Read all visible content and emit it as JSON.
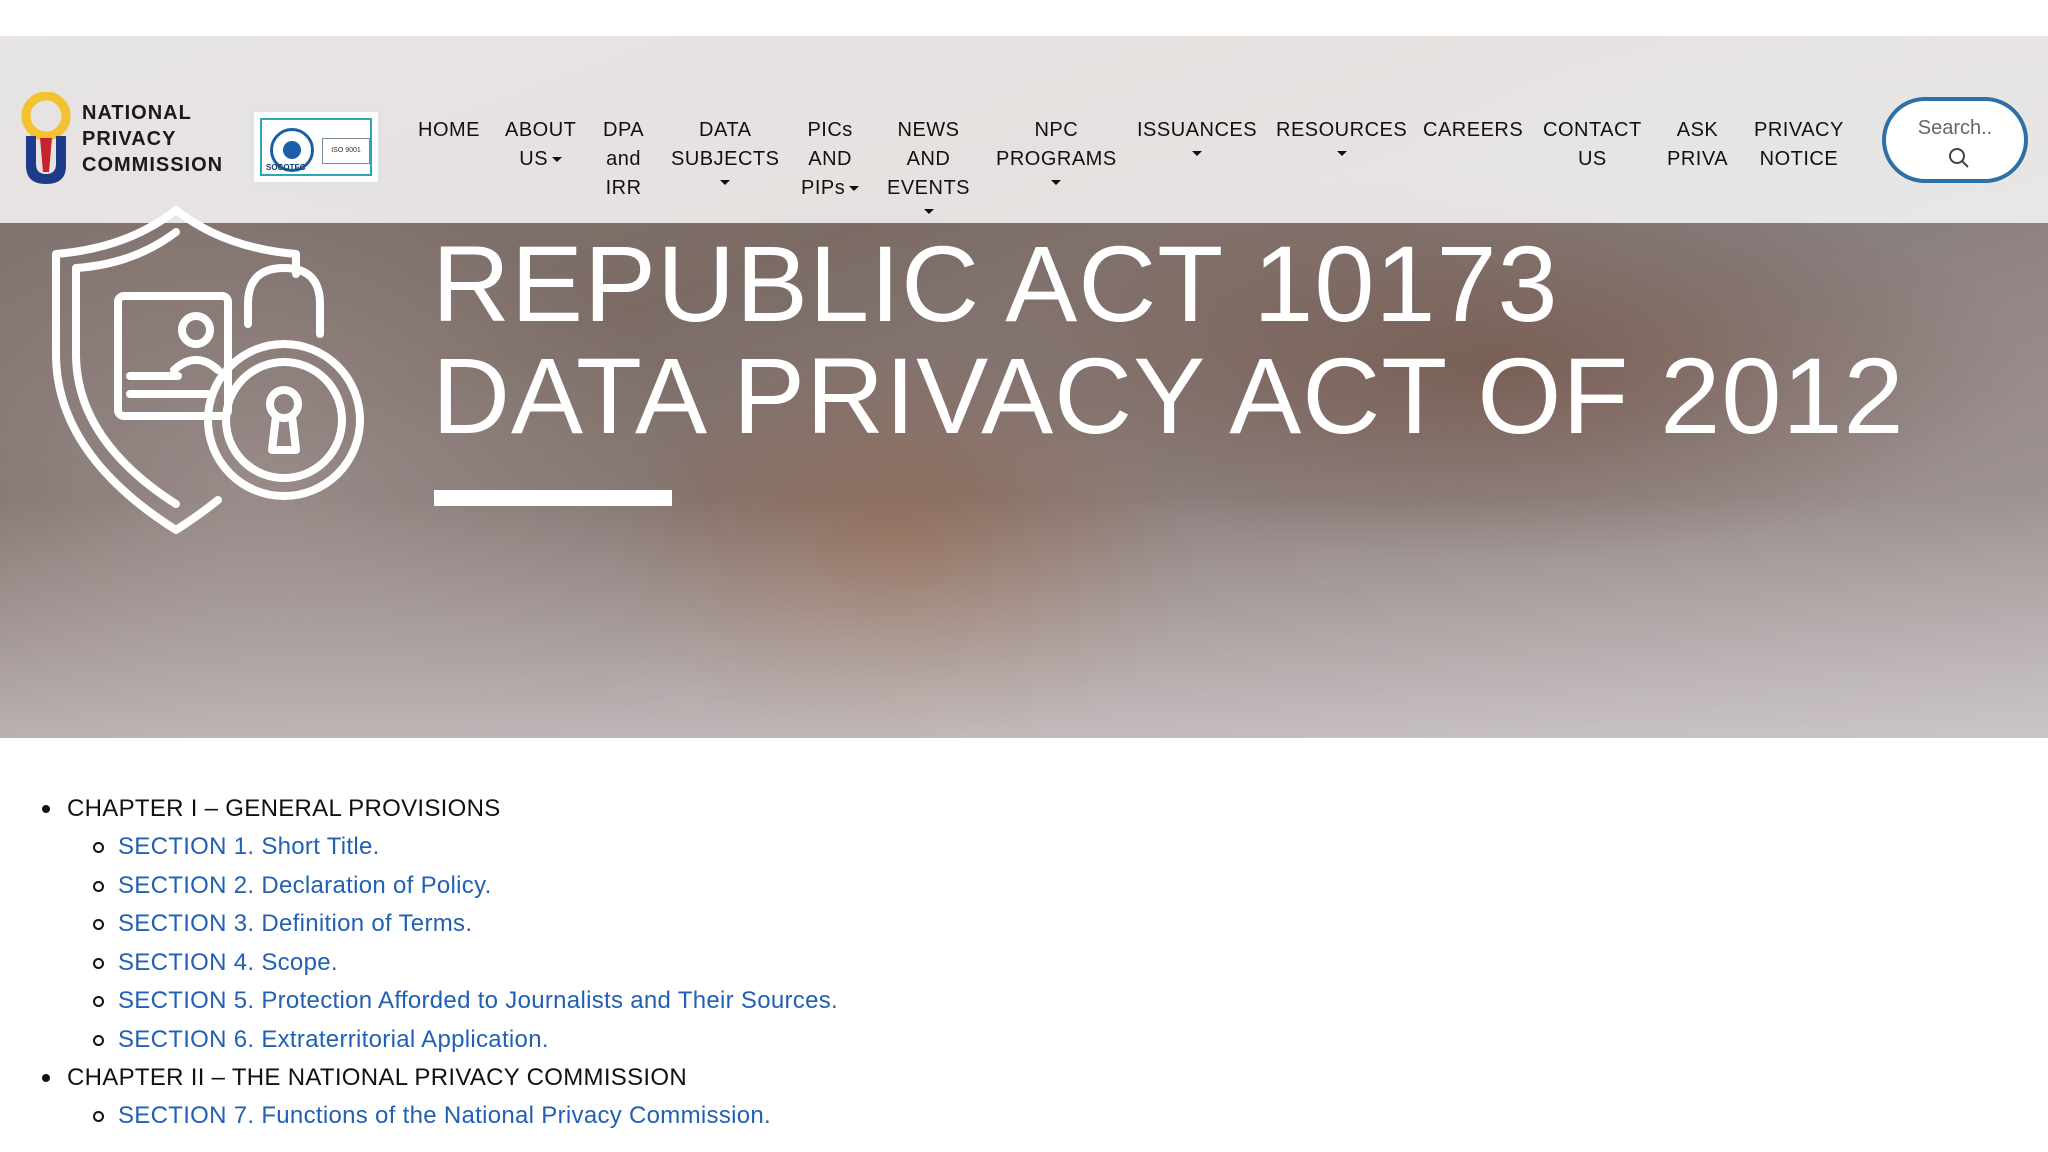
{
  "logo": {
    "line1": "NATIONAL",
    "line2": "PRIVACY",
    "line3": "COMMISSION",
    "colors": {
      "yellow": "#f2c230",
      "blue": "#1e3a8a",
      "red": "#c8232c"
    }
  },
  "certification": {
    "brand": "SOCOTEC",
    "standard": "ISO 9001"
  },
  "nav": {
    "home": "HOME",
    "about_1": "ABOUT",
    "about_2": "US",
    "dpa_1": "DPA",
    "dpa_2": "and",
    "dpa_3": "IRR",
    "data_1": "DATA",
    "data_2": "SUBJECTS",
    "pics_1": "PICs",
    "pics_2": "AND",
    "pics_3": "PIPs",
    "news_1": "NEWS",
    "news_2": "AND",
    "news_3": "EVENTS",
    "npc_1": "NPC",
    "npc_2": "PROGRAMS",
    "issuances": "ISSUANCES",
    "resources": "RESOURCES",
    "careers": "CAREERS",
    "contact_1": "CONTACT",
    "contact_2": "US",
    "ask_1": "ASK",
    "ask_2": "PRIVA",
    "privacy_1": "PRIVACY",
    "privacy_2": "NOTICE"
  },
  "search": {
    "placeholder": "Search.."
  },
  "hero": {
    "title_line1": "REPUBLIC ACT 10173",
    "title_line2": "DATA PRIVACY ACT OF 2012"
  },
  "toc": {
    "chapter1": {
      "title": "CHAPTER I – GENERAL PROVISIONS",
      "sections": [
        "SECTION 1. Short Title.",
        "SECTION 2. Declaration of Policy.",
        "SECTION 3. Definition of Terms.",
        "SECTION 4. Scope.",
        "SECTION 5. Protection Afforded to Journalists and Their Sources.",
        "SECTION 6. Extraterritorial Application."
      ]
    },
    "chapter2": {
      "title": "CHAPTER II – THE NATIONAL PRIVACY COMMISSION",
      "sections": [
        "SECTION 7. Functions of the National Privacy Commission."
      ]
    }
  },
  "colors": {
    "link": "#2160b5",
    "search_border": "#2d6fa8"
  }
}
